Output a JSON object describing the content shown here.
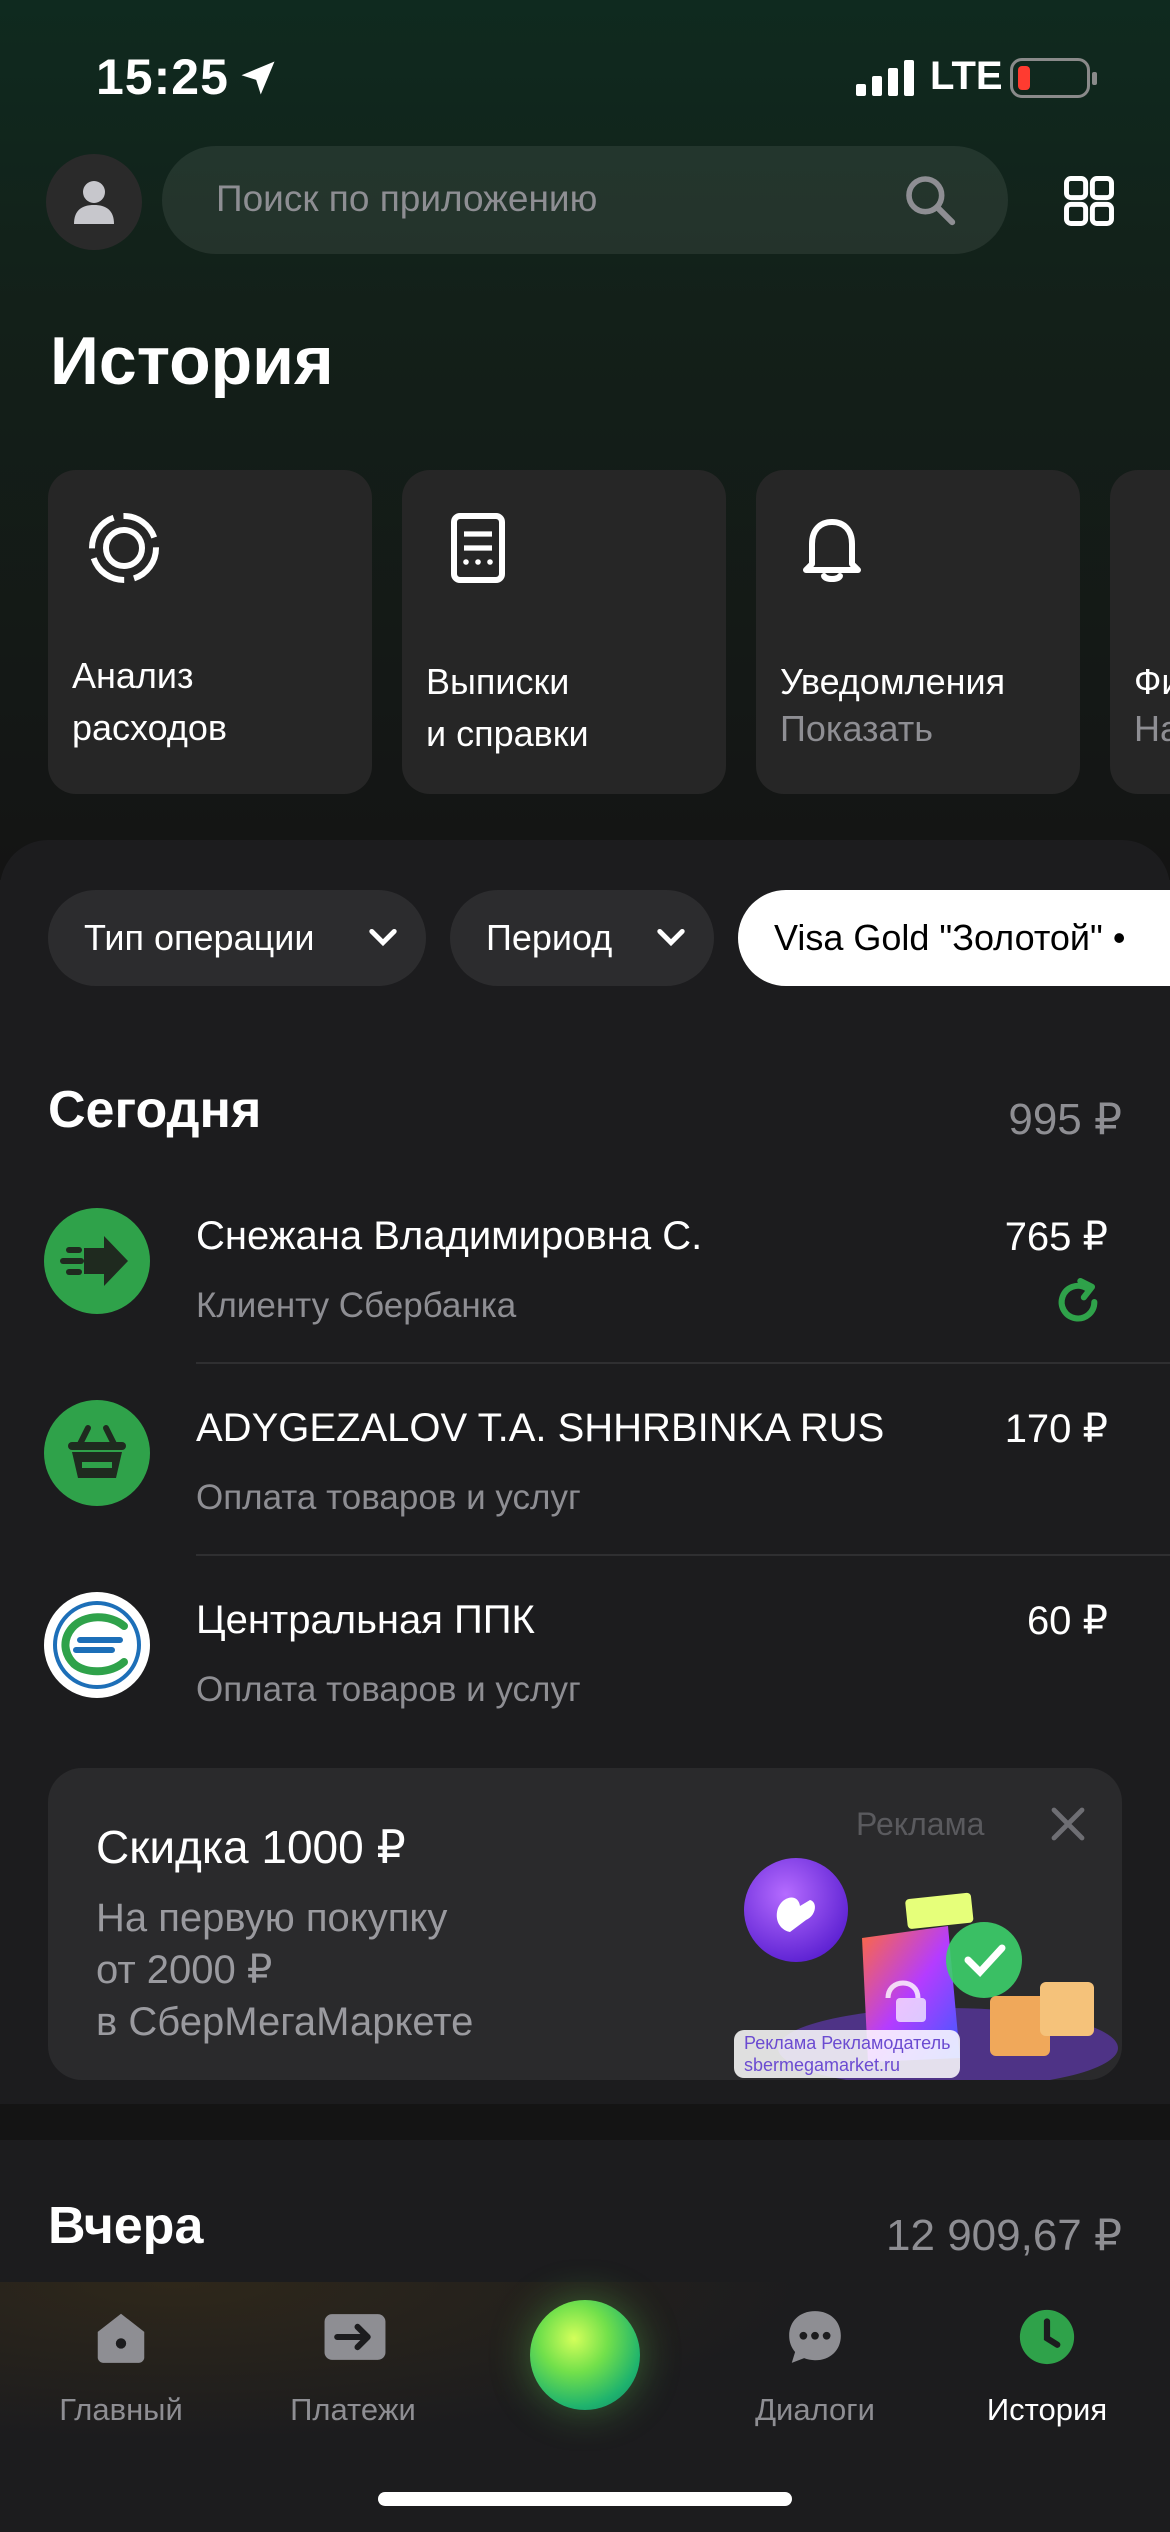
{
  "status_bar": {
    "time": "15:25",
    "network": "LTE"
  },
  "search": {
    "placeholder": "Поиск по приложению"
  },
  "page_title": "История",
  "cards": [
    {
      "title": "Анализ\nрасходов",
      "subtitle": ""
    },
    {
      "title": "Выписки\nи справки",
      "subtitle": ""
    },
    {
      "title": "Уведомления",
      "subtitle": "Показать"
    },
    {
      "title": "Фи",
      "subtitle": "На"
    }
  ],
  "filters": [
    {
      "label": "Тип операции"
    },
    {
      "label": "Период"
    },
    {
      "label": "Visa Gold \"Золотой\" •"
    }
  ],
  "today": {
    "title": "Сегодня",
    "total": "995 ₽",
    "transactions": [
      {
        "name": "Снежана Владимировна С.",
        "category": "Клиенту Сбербанка",
        "amount": "765 ₽",
        "icon": "transfer-arrow-icon",
        "color": "#2fa24a"
      },
      {
        "name": "ADYGEZALOV T.A. SHHRBINKA RUS",
        "category": "Оплата товаров и услуг",
        "amount": "170 ₽",
        "icon": "shopping-basket-icon",
        "color": "#2fa24a"
      },
      {
        "name": "Центральная ППК",
        "category": "Оплата товаров и услуг",
        "amount": "60 ₽",
        "icon": "railway-logo-icon",
        "color": "#ffffff"
      }
    ]
  },
  "ad": {
    "title": "Скидка 1000 ₽",
    "body": "На первую покупку\nот 2000 ₽\nв СберМегаМаркете",
    "label": "Реклама",
    "caption_1": "Реклама Рекламодатель",
    "caption_2": "sbermegamarket.ru"
  },
  "yesterday": {
    "title": "Вчера",
    "total": "12 909,67 ₽"
  },
  "tabs": [
    {
      "label": "Главный",
      "icon": "home-icon"
    },
    {
      "label": "Платежи",
      "icon": "payments-icon"
    },
    {
      "label": "",
      "icon": "assistant-orb-icon"
    },
    {
      "label": "Диалоги",
      "icon": "chat-icon"
    },
    {
      "label": "История",
      "icon": "clock-icon",
      "active": true
    }
  ],
  "colors": {
    "accent": "#2fa24a",
    "background": "#1c1c1e",
    "card": "#262626"
  }
}
